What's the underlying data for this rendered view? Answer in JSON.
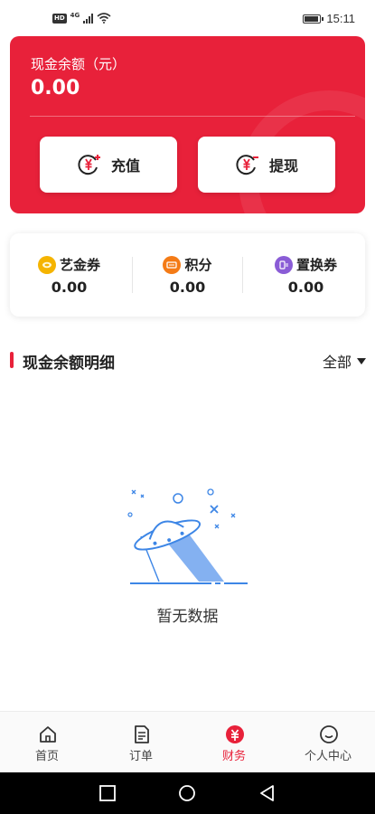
{
  "status_bar": {
    "network": "4G",
    "hd": "HD",
    "time": "15:11"
  },
  "balance": {
    "label": "现金余额（元）",
    "value": "0.00",
    "recharge_label": "充值",
    "withdraw_label": "提现"
  },
  "coupons": [
    {
      "label": "艺金券",
      "value": "0.00"
    },
    {
      "label": "积分",
      "value": "0.00"
    },
    {
      "label": "置换券",
      "value": "0.00"
    }
  ],
  "detail": {
    "title": "现金余额明细",
    "filter": "全部"
  },
  "empty": {
    "text": "暂无数据"
  },
  "bottom_nav": [
    {
      "label": "首页"
    },
    {
      "label": "订单"
    },
    {
      "label": "财务"
    },
    {
      "label": "个人中心"
    }
  ],
  "colors": {
    "accent": "#e8213a",
    "gold": "#f5b400",
    "orange": "#f47b16",
    "purple": "#8a5cd6",
    "illustration_blue": "#3d86e6"
  }
}
